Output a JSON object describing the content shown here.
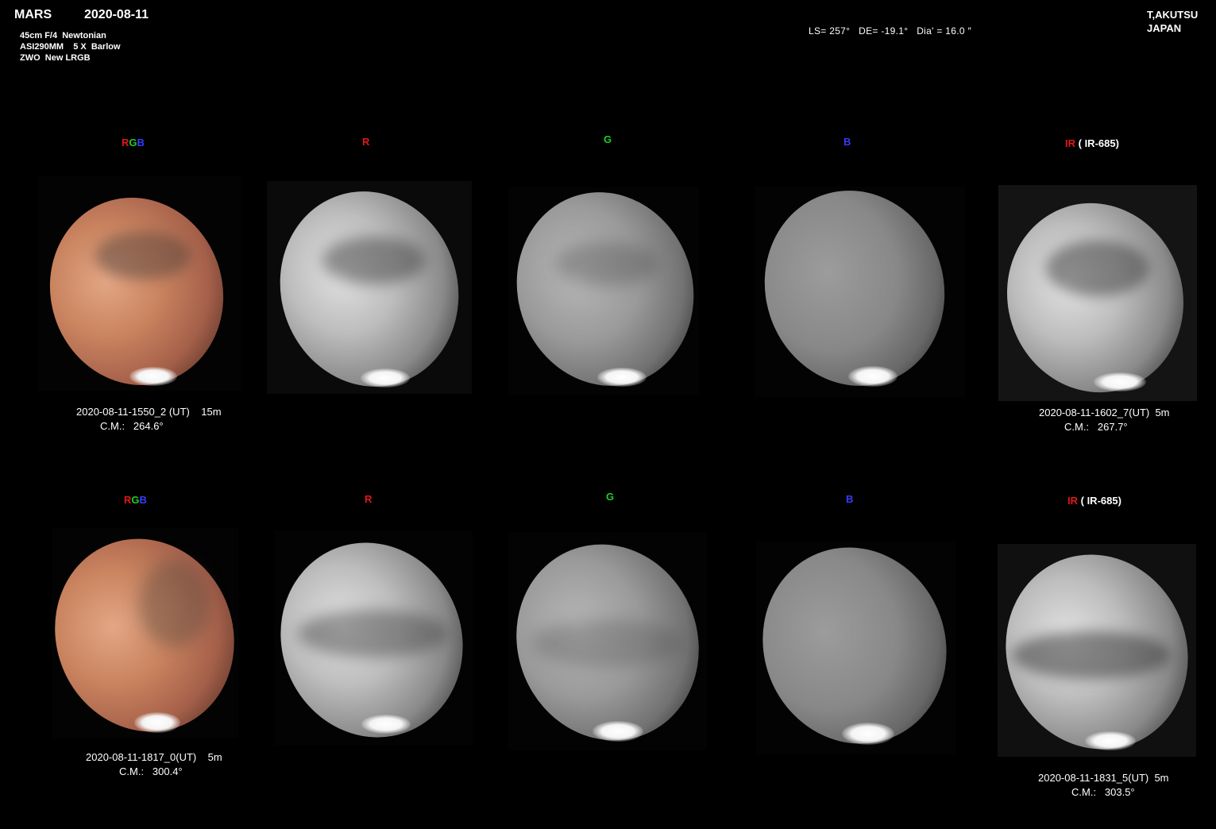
{
  "header": {
    "object": "MARS",
    "date": "2020-08-11",
    "equipment": [
      "45cm F/4  Newtonian",
      "ASI290MM    5 X  Barlow",
      "ZWO  New LRGB"
    ],
    "params": "LS= 257°   DE= -19.1°   Dia' = 16.0 ″",
    "author": [
      "T,AKUTSU",
      "JAPAN"
    ]
  },
  "filters": {
    "rgb_letters": [
      "R",
      "G",
      "B"
    ],
    "r": "R",
    "g": "G",
    "b": "B",
    "ir_prefix": "IR",
    "ir_suffix": "( IR-685)"
  },
  "colors": {
    "red": "#e01818",
    "green": "#1ecc2a",
    "blue": "#3a3aff"
  },
  "rows": [
    {
      "left_caption": [
        "2020-08-11-1550_2 (UT)    15m",
        "C.M.:   264.6°"
      ],
      "right_caption": [
        "2020-08-11-1602_7(UT)  5m",
        "C.M.:   267.7°"
      ]
    },
    {
      "left_caption": [
        "2020-08-11-1817_0(UT)    5m",
        "C.M.:   300.4°"
      ],
      "right_caption": [
        "2020-08-11-1831_5(UT)  5m",
        "C.M.:   303.5°"
      ]
    }
  ]
}
